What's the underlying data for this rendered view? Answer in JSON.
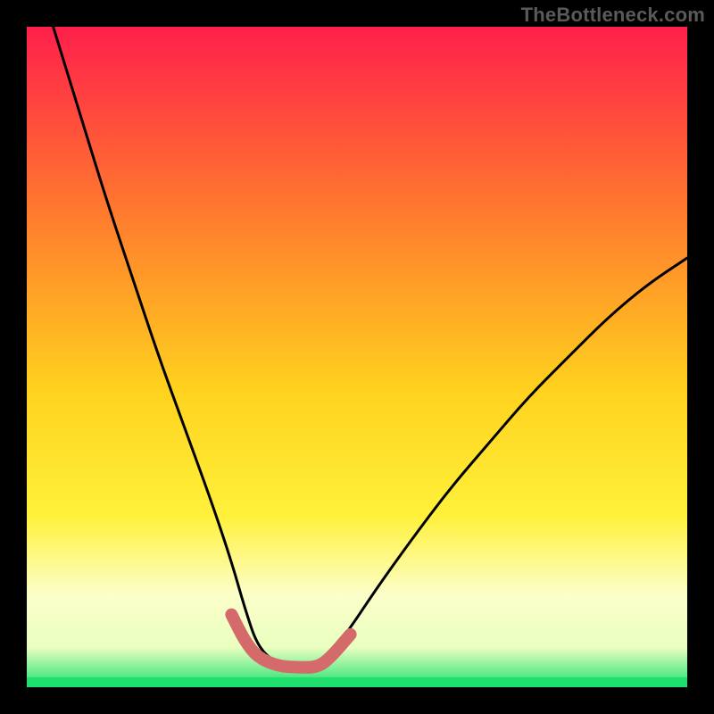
{
  "watermark": "TheBottleneck.com",
  "colors": {
    "black": "#000000",
    "curve": "#000000",
    "marker": "#d46a6a",
    "green_band": "#1fe06d",
    "gradient_top": "#ff1f4b",
    "gradient_mid1": "#ff7a2e",
    "gradient_mid2": "#ffd21e",
    "gradient_mid3": "#fff13a",
    "gradient_pale": "#fcffc9",
    "gradient_pale2": "#e9ffc0"
  },
  "chart_data": {
    "type": "line",
    "title": "",
    "xlabel": "",
    "ylabel": "",
    "xlim": [
      0,
      100
    ],
    "ylim": [
      0,
      100
    ],
    "grid": false,
    "note": "Axes are unlabeled/normalized 0–100. Left branch descends steeply; minimum plateau ~x=35–46 near y=3; right branch rises with decreasing slope. Pink segment marks the region around the minimum.",
    "series": [
      {
        "name": "curve",
        "color": "#000000",
        "x": [
          4,
          8,
          12,
          16,
          20,
          24,
          28,
          31,
          33,
          35,
          38,
          41,
          44,
          46,
          49,
          53,
          58,
          64,
          70,
          76,
          82,
          88,
          94,
          100
        ],
        "y": [
          100,
          87,
          74,
          62,
          50,
          39,
          28,
          19,
          12,
          6,
          3.5,
          3,
          3,
          5,
          9,
          15,
          22,
          30,
          37,
          44,
          50,
          56,
          61,
          65
        ]
      },
      {
        "name": "min-marker",
        "color": "#d46a6a",
        "x": [
          31,
          33,
          35,
          38,
          41,
          44,
          46,
          49
        ],
        "y": [
          11,
          7,
          4.5,
          3.2,
          3,
          3,
          4.5,
          8
        ]
      }
    ],
    "bands": [
      {
        "name": "green-floor",
        "y_from": 0,
        "y_to": 1.5,
        "color": "#1fe06d"
      }
    ]
  },
  "geometry": {
    "outer_w": 800,
    "outer_h": 800,
    "inner_x": 30,
    "inner_y": 30,
    "inner_w": 740,
    "inner_h": 740
  }
}
